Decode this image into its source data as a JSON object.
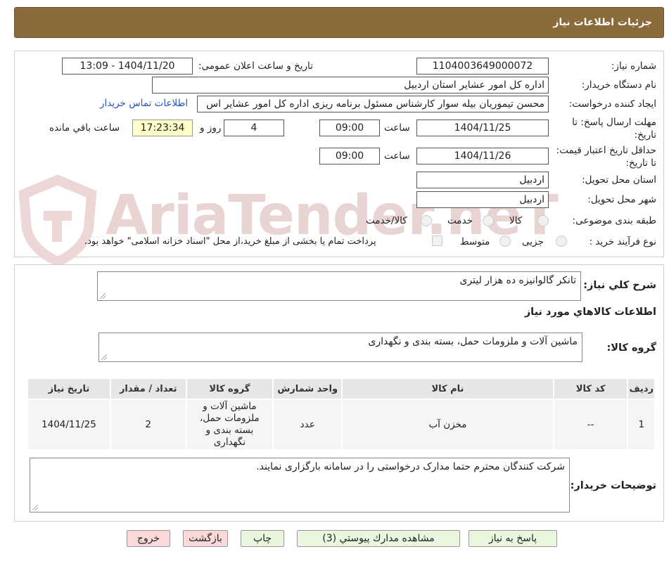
{
  "header": {
    "title": "جزئیات اطلاعات نیاز"
  },
  "watermark": {
    "text": "AriaTender.neT"
  },
  "form": {
    "need_number_label": "شماره نیاز:",
    "need_number": "1104003649000072",
    "announce_label": "تاریخ و ساعت اعلان عمومی:",
    "announce_value": "1404/11/20 - 13:09",
    "buyer_label": "نام دستگاه خریدار:",
    "buyer_value": "اداره کل امور عشایر استان اردبیل",
    "creator_label": "ایجاد کننده درخواست:",
    "creator_value": "محسن تیموریان بیله سوار کارشناس مسئول برنامه ریزی اداره کل امور عشایر اس",
    "contact_link": "اطلاعات تماس خریدار",
    "deadline_label": "مهلت ارسال پاسخ: تا تاریخ:",
    "deadline_date": "1404/11/25",
    "time_label": "ساعت",
    "deadline_time": "09:00",
    "days_value": "4",
    "days_label": "روز و",
    "remaining_time": "17:23:34",
    "remaining_label": "ساعت باقي مانده",
    "validity_label": "حداقل تاریخ اعتبار قیمت: تا تاریخ:",
    "validity_date": "1404/11/26",
    "validity_time": "09:00",
    "province_label": "استان محل تحویل:",
    "province_value": "اردبیل",
    "city_label": "شهر محل تحویل:",
    "city_value": "اردبیل",
    "category_label": "طبقه بندی موضوعی:",
    "category_options": [
      "کالا",
      "خدمت",
      "کالا/خدمت"
    ],
    "process_label": "نوع فرآیند خرید :",
    "process_options": [
      "جزیی",
      "متوسط"
    ],
    "payment_note": "پرداخت تمام یا بخشی از مبلغ خرید،از محل \"اسناد خزانه اسلامی\" خواهد بود."
  },
  "description": {
    "label": "شرح کلي نياز:",
    "value": "تانکر گالوانیزه ده هزار لیتری"
  },
  "goods_info_title": "اطلاعات كالاهاي مورد نياز",
  "goods_group": {
    "label": "گروه کالا:",
    "value": "ماشین آلات و ملزومات حمل، بسته بندی و نگهداری"
  },
  "table": {
    "headers": [
      "رديف",
      "کد کالا",
      "نام کالا",
      "واحد شمارش",
      "گروه کالا",
      "تعداد / مقدار",
      "تاریخ نیاز"
    ],
    "rows": [
      [
        "1",
        "--",
        "مخزن آب",
        "عدد",
        "ماشین آلات و ملزومات حمل، بسته بندی و نگهداری",
        "2",
        "1404/11/25"
      ]
    ]
  },
  "buyer_notes": {
    "label": "توضیحات خریدار:",
    "value": "شرکت کنندگان محترم حتما مدارک درخواستی را در سامانه بارگزاری نمایند."
  },
  "buttons": {
    "reply": "پاسخ به نیاز",
    "attachments": "مشاهده مدارك پيوستي (3)",
    "print": "چاپ",
    "back": "بازگشت",
    "exit": "خروج"
  },
  "colors": {
    "header_bg": "#8b6a3c",
    "link": "#2255bb",
    "remaining_bg": "#ffffc9"
  }
}
